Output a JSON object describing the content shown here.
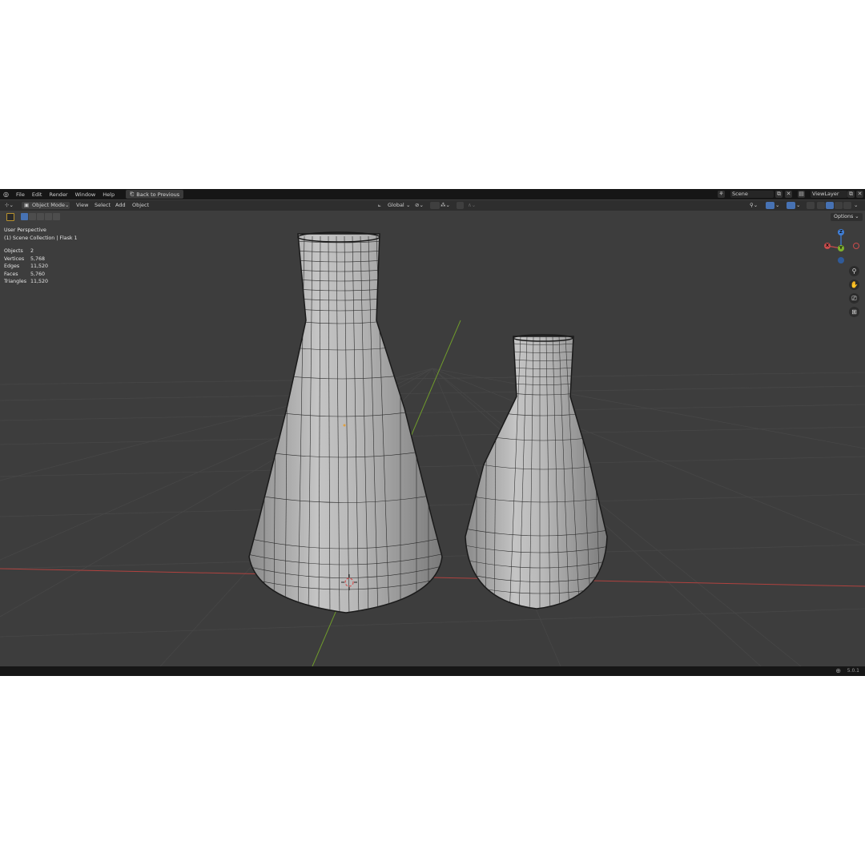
{
  "menu": {
    "items": [
      "File",
      "Edit",
      "Render",
      "Window",
      "Help"
    ],
    "back_button": "Back to Previous"
  },
  "topbar": {
    "scene": "Scene",
    "view_layer": "ViewLayer"
  },
  "header": {
    "mode": "Object Mode",
    "menus": [
      "View",
      "Select",
      "Add",
      "Object"
    ],
    "transform_orientation": "Global"
  },
  "viewport": {
    "perspective": "User Perspective",
    "collection": "(1) Scene Collection | Flask 1",
    "options_label": "Options",
    "stats": [
      {
        "label": "Objects",
        "value": "2"
      },
      {
        "label": "Vertices",
        "value": "5,768"
      },
      {
        "label": "Edges",
        "value": "11,520"
      },
      {
        "label": "Faces",
        "value": "5,760"
      },
      {
        "label": "Triangles",
        "value": "11,520"
      }
    ],
    "gizmo": {
      "x": "X",
      "y": "Y",
      "z": "Z"
    },
    "objects": [
      "Flask 1",
      "Flask 2"
    ]
  },
  "colors": {
    "accent": "#4772b3",
    "axis_x": "#c94c4c",
    "axis_y": "#7fb22c",
    "axis_z": "#3f7fd9"
  },
  "statusbar": {
    "version": "5.0.1"
  }
}
